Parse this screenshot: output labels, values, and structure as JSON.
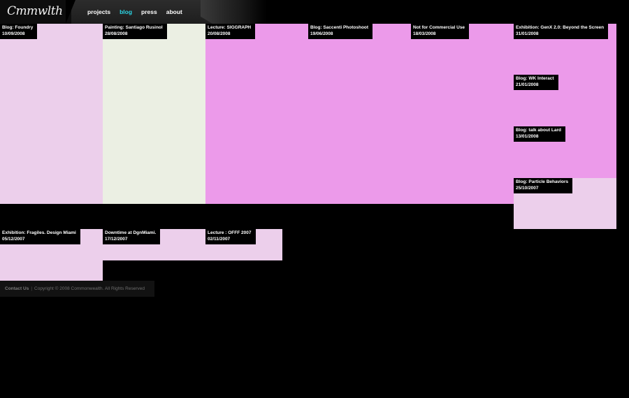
{
  "header": {
    "logo_text": "Cmmwlth",
    "nav": [
      {
        "label": "projects"
      },
      {
        "label": "blog"
      },
      {
        "label": "press"
      },
      {
        "label": "about"
      }
    ]
  },
  "colors": {
    "light_pink": "#eccfeb",
    "pale_green": "#ebefe3",
    "magenta": "#ec9aea",
    "nav_active": "#2ad6e6"
  },
  "posts": [
    {
      "title": "Blog: Foundry",
      "date": "10/09/2008"
    },
    {
      "title": "Painting: Santiago Rusinol",
      "date": "28/08/2008"
    },
    {
      "title": "Lecture: SIGGRAPH",
      "date": "20/08/2008"
    },
    {
      "title": "Blog: Saccenti Photoshoot",
      "date": "19/06/2008"
    },
    {
      "title": "Not for Commercial Use",
      "date": "18/03/2008"
    },
    {
      "title": "Exhibition: GenX 2.0: Beyond the Screen",
      "date": "31/01/2008"
    },
    {
      "title": "Blog: WK Interact",
      "date": "21/01/2008"
    },
    {
      "title": "Blog: talk about Lard",
      "date": "13/01/2008"
    },
    {
      "title": "Blog: Particle Behaviors",
      "date": "25/10/2007"
    },
    {
      "title": "Exhibition: Fragiles. Design Miami",
      "date": "05/12/2007"
    },
    {
      "title": "Downtime at DgnMiami.",
      "date": "17/12/2007"
    },
    {
      "title": "Lecture : OFFF 2007",
      "date": "02/11/2007"
    }
  ],
  "footer": {
    "contact": "Contact Us",
    "separator": "|",
    "copyright": "Copyright © 2008 Commonwealth. All Rights Reserved"
  }
}
